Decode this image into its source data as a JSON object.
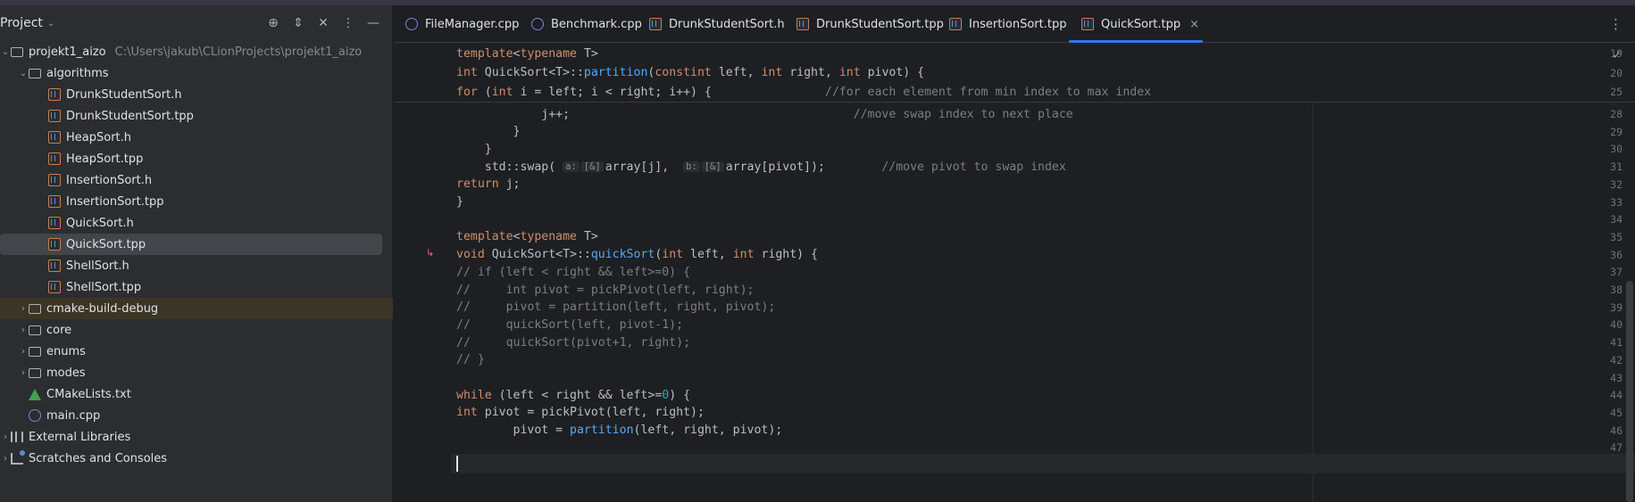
{
  "project_panel": {
    "title": "Project",
    "tree": [
      {
        "label": "projekt1_aizo",
        "path": "C:\\Users\\jakub\\CLionProjects\\projekt1_aizo",
        "type": "folder",
        "expanded": true
      },
      {
        "label": "algorithms",
        "type": "folder",
        "expanded": true
      },
      {
        "label": "DrunkStudentSort.h",
        "type": "h"
      },
      {
        "label": "DrunkStudentSort.tpp",
        "type": "h"
      },
      {
        "label": "HeapSort.h",
        "type": "h"
      },
      {
        "label": "HeapSort.tpp",
        "type": "h"
      },
      {
        "label": "InsertionSort.h",
        "type": "h"
      },
      {
        "label": "InsertionSort.tpp",
        "type": "h"
      },
      {
        "label": "QuickSort.h",
        "type": "h"
      },
      {
        "label": "QuickSort.tpp",
        "type": "h",
        "selected": true
      },
      {
        "label": "ShellSort.h",
        "type": "h"
      },
      {
        "label": "ShellSort.tpp",
        "type": "h"
      },
      {
        "label": "cmake-build-debug",
        "type": "folder",
        "expanded": false
      },
      {
        "label": "core",
        "type": "folder",
        "expanded": false
      },
      {
        "label": "enums",
        "type": "folder",
        "expanded": false
      },
      {
        "label": "modes",
        "type": "folder",
        "expanded": false
      },
      {
        "label": "CMakeLists.txt",
        "type": "cmake"
      },
      {
        "label": "main.cpp",
        "type": "cpp"
      },
      {
        "label": "External Libraries",
        "type": "lib"
      },
      {
        "label": "Scratches and Consoles",
        "type": "scratch"
      }
    ]
  },
  "tabs": [
    {
      "label": "FileManager.cpp",
      "icon": "cpp-file-icon"
    },
    {
      "label": "Benchmark.cpp",
      "icon": "cpp-file-icon"
    },
    {
      "label": "DrunkStudentSort.h",
      "icon": "header-file-icon"
    },
    {
      "label": "DrunkStudentSort.tpp",
      "icon": "header-file-icon"
    },
    {
      "label": "InsertionSort.tpp",
      "icon": "header-file-icon"
    },
    {
      "label": "QuickSort.tpp",
      "icon": "header-file-icon",
      "active": true,
      "close": "×"
    }
  ],
  "more_glyph": "⋮",
  "inspection_glyph": "✓",
  "code": {
    "sticky": [
      {
        "ln": "19",
        "text": "template<typename T>"
      },
      {
        "ln": "20",
        "text": "int QuickSort<T>::partition(const int left, int right, int pivot) {"
      },
      {
        "ln": "25",
        "text": "    for (int i = left; i < right; i++) {                //for each element from min index to max index"
      }
    ],
    "lines": [
      {
        "ln": "28",
        "text": "            j++;                                        //move swap index to next place"
      },
      {
        "ln": "29",
        "text": "        }"
      },
      {
        "ln": "30",
        "text": "    }"
      },
      {
        "ln": "31",
        "text": "    std::swap( a: [&] array[j],  b: [&] array[pivot]);        //move pivot to swap index"
      },
      {
        "ln": "32",
        "text": "    return j;"
      },
      {
        "ln": "33",
        "text": "}"
      },
      {
        "ln": "34",
        "text": ""
      },
      {
        "ln": "35",
        "text": "template<typename T>"
      },
      {
        "ln": "36",
        "text": "void QuickSort<T>::quickSort(int left, int right) {"
      },
      {
        "ln": "37",
        "text": "    // if (left < right && left>=0) {"
      },
      {
        "ln": "38",
        "text": "    //     int pivot = pickPivot(left, right);"
      },
      {
        "ln": "39",
        "text": "    //     pivot = partition(left, right, pivot);"
      },
      {
        "ln": "40",
        "text": "    //     quickSort(left, pivot-1);"
      },
      {
        "ln": "41",
        "text": "    //     quickSort(pivot+1, right);"
      },
      {
        "ln": "42",
        "text": "    // }"
      },
      {
        "ln": "43",
        "text": ""
      },
      {
        "ln": "44",
        "text": "    while (left < right && left>=0) {"
      },
      {
        "ln": "45",
        "text": "        int pivot = pickPivot(left, right);"
      },
      {
        "ln": "46",
        "text": "        pivot = partition(left, right, pivot);"
      },
      {
        "ln": "47",
        "text": ""
      }
    ]
  }
}
